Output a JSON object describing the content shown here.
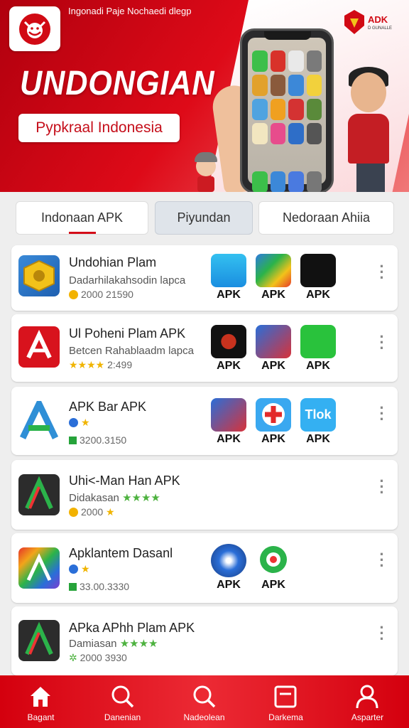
{
  "header": {
    "tagline": "Ingonadi Paje Nochaedi dlegp",
    "brand": "ADK",
    "brand_sub": "D GUNALLE",
    "headline": "UNDONGIAN",
    "subtitle": "Pypkraal Indonesia"
  },
  "tabs": [
    {
      "label": "Indonaan APK",
      "selected": false
    },
    {
      "label": "Piyundan",
      "selected": true
    },
    {
      "label": "Nedoraan Ahiia",
      "selected": false
    }
  ],
  "apps": [
    {
      "title": "Undohian Plam",
      "subtitle": "Dadarhilakahsodin lapca",
      "meta": "2000 21590",
      "apk_labels": [
        "APK",
        "APK",
        "APK"
      ]
    },
    {
      "title": "Ul Poheni Plam APK",
      "subtitle": "Betcen Rahablaadm lapca",
      "meta": "2:499",
      "apk_labels": [
        "APK",
        "APK",
        "APK"
      ]
    },
    {
      "title": "APK Bar APK",
      "subtitle": "",
      "meta": "3200.3150",
      "apk_labels": [
        "APK",
        "APK",
        "APK"
      ]
    },
    {
      "title": "Uhi<-Man Han APK",
      "subtitle": "Didakasan",
      "meta": "2000",
      "apk_labels": []
    },
    {
      "title": "Apklantem Dasanl",
      "subtitle": "",
      "meta": "33.00.3330",
      "apk_labels": [
        "APK",
        "APK"
      ]
    },
    {
      "title": "APka APhh Plam APK",
      "subtitle": "Damiasan",
      "meta": "2000 3930",
      "apk_labels": []
    }
  ],
  "apk_icon_text": "Tlok",
  "nav": [
    {
      "label": "Bagant",
      "icon": "home-icon"
    },
    {
      "label": "Danenian",
      "icon": "search-icon"
    },
    {
      "label": "Nadeolean",
      "icon": "search-icon"
    },
    {
      "label": "Darkema",
      "icon": "window-icon"
    },
    {
      "label": "Asparter",
      "icon": "user-icon"
    }
  ],
  "colors": {
    "accent": "#d40d19",
    "nav_bg": "#e0101c",
    "card_bg": "#ffffff",
    "page_bg": "#eeeeee"
  }
}
